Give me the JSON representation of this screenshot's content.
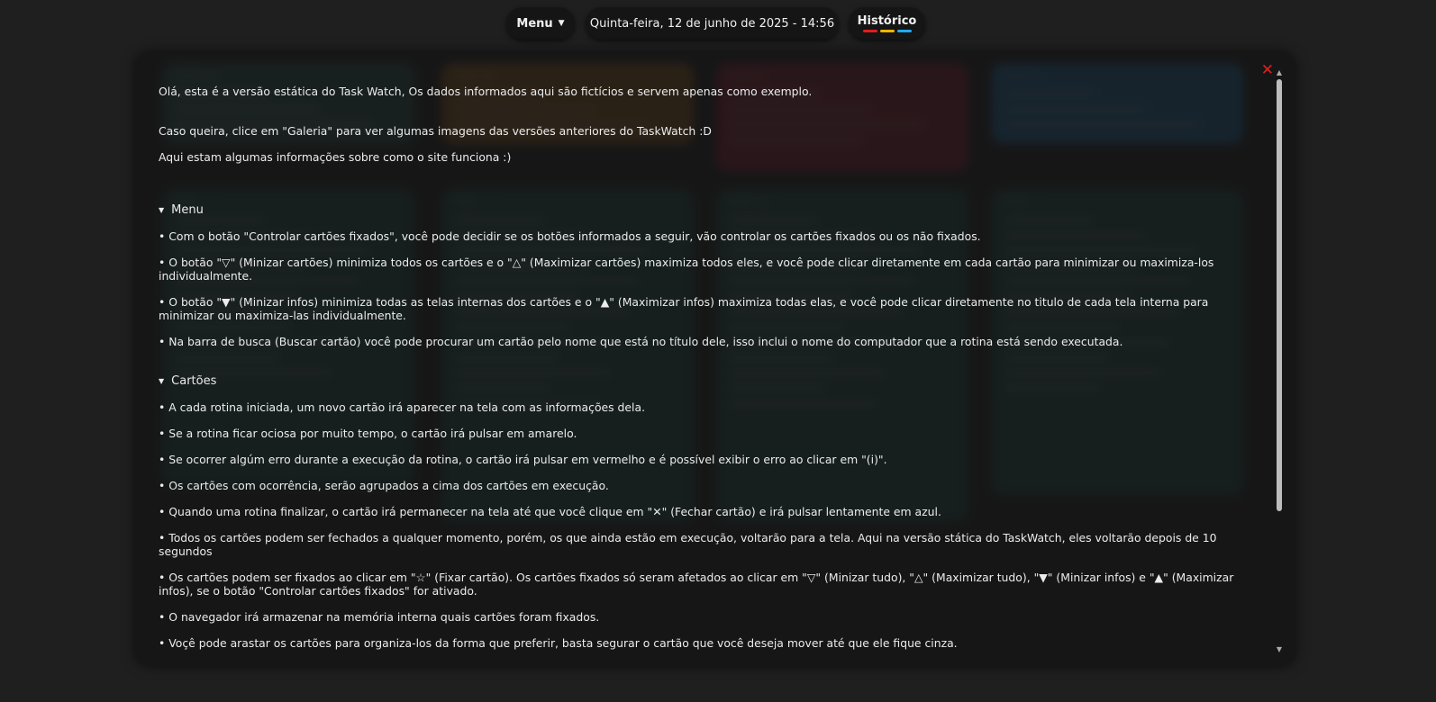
{
  "topbar": {
    "menu_label": "Menu",
    "caret_icon": "caret-down-icon",
    "datetime": "Quinta-feira, 12 de junho de 2025 - 14:56",
    "history_label": "Histórico",
    "history_bar_colors": [
      "#e01e1e",
      "#f0b400",
      "#1eaaf0"
    ]
  },
  "background_cards": [
    {
      "color": "#2f6f66",
      "title": "PCAS xxx"
    },
    {
      "color": "#c07418",
      "title": "PCAS 367"
    },
    {
      "color": "#b81e3a",
      "title": "PCAS xx"
    },
    {
      "color": "#1e8ad6",
      "title": "PCAS xx"
    },
    {
      "color": "#1f5f5a",
      "title": "PCAS ...."
    },
    {
      "color": "#1f5f5a",
      "title": "PCAS ...."
    },
    {
      "color": "#1f5f5a",
      "title": "PCAS xxx"
    },
    {
      "color": "#1f5f5a",
      "title": "PCAS ..."
    }
  ],
  "modal": {
    "close_icon": "close-icon",
    "intro": [
      "Olá, esta é a versão estática do Task Watch, Os dados informados aqui são fictícios e servem apenas como exemplo.",
      "Caso queira, clice em \"Galeria\" para ver algumas imagens das versões anteriores do TaskWatch :D",
      "Aqui estam algumas informações sobre como o site funciona :)"
    ],
    "menu_section": {
      "title": "Menu",
      "items": [
        "• Com o botão \"Controlar cartões fixados\", você pode decidir se os botões informados a seguir, vão controlar os cartões fixados ou os não fixados.",
        "• O botão \"▽\" (Minizar cartões) minimiza todos os cartões e o \"△\" (Maximizar cartões) maximiza todos eles, e você pode clicar diretamente em cada cartão para minimizar ou maximiza-los individualmente.",
        "• O botão \"▼\" (Minizar infos) minimiza todas as telas internas dos cartões e o \"▲\" (Maximizar infos) maximiza todas elas, e você pode clicar diretamente no titulo de cada tela interna para minimizar ou maximiza-las individualmente.",
        "• Na barra de busca (Buscar cartão) você pode procurar um cartão pelo nome que está no título dele, isso inclui o nome do computador que a rotina está sendo executada."
      ]
    },
    "cards_section": {
      "title": "Cartões",
      "items": [
        "• A cada rotina iniciada, um novo cartão irá aparecer na tela com as informações dela.",
        "• Se a rotina ficar ociosa por muito tempo, o cartão irá pulsar em amarelo.",
        "• Se ocorrer algúm erro durante a execução da rotina, o cartão irá pulsar em vermelho e é possível exibir o erro ao clicar em \"(i)\".",
        "• Os cartões com ocorrência, serão agrupados a cima dos cartões em execução.",
        "• Quando uma rotina finalizar, o cartão irá permanecer na tela até que você clique em \"✕\" (Fechar cartão) e irá pulsar lentamente em azul.",
        "• Todos os cartões podem ser fechados a qualquer momento, porém, os que ainda estão em execução, voltarão para a tela. Aqui na versão stática do TaskWatch, eles voltarão depois de 10 segundos",
        "• Os cartões podem ser fixados ao clicar em \"☆\" (Fixar cartão). Os cartões fixados só seram afetados ao clicar em \"▽\" (Minizar tudo), \"△\" (Maximizar tudo), \"▼\" (Minizar infos) e \"▲\" (Maximizar infos), se o botão \"Controlar cartões fixados\" for ativado.",
        "• O navegador irá armazenar na memória interna quais cartões foram fixados.",
        "• Voçê pode arastar os cartões para organiza-los da forma que preferir, basta segurar o cartão que você deseja mover até que ele fique cinza."
      ]
    }
  }
}
